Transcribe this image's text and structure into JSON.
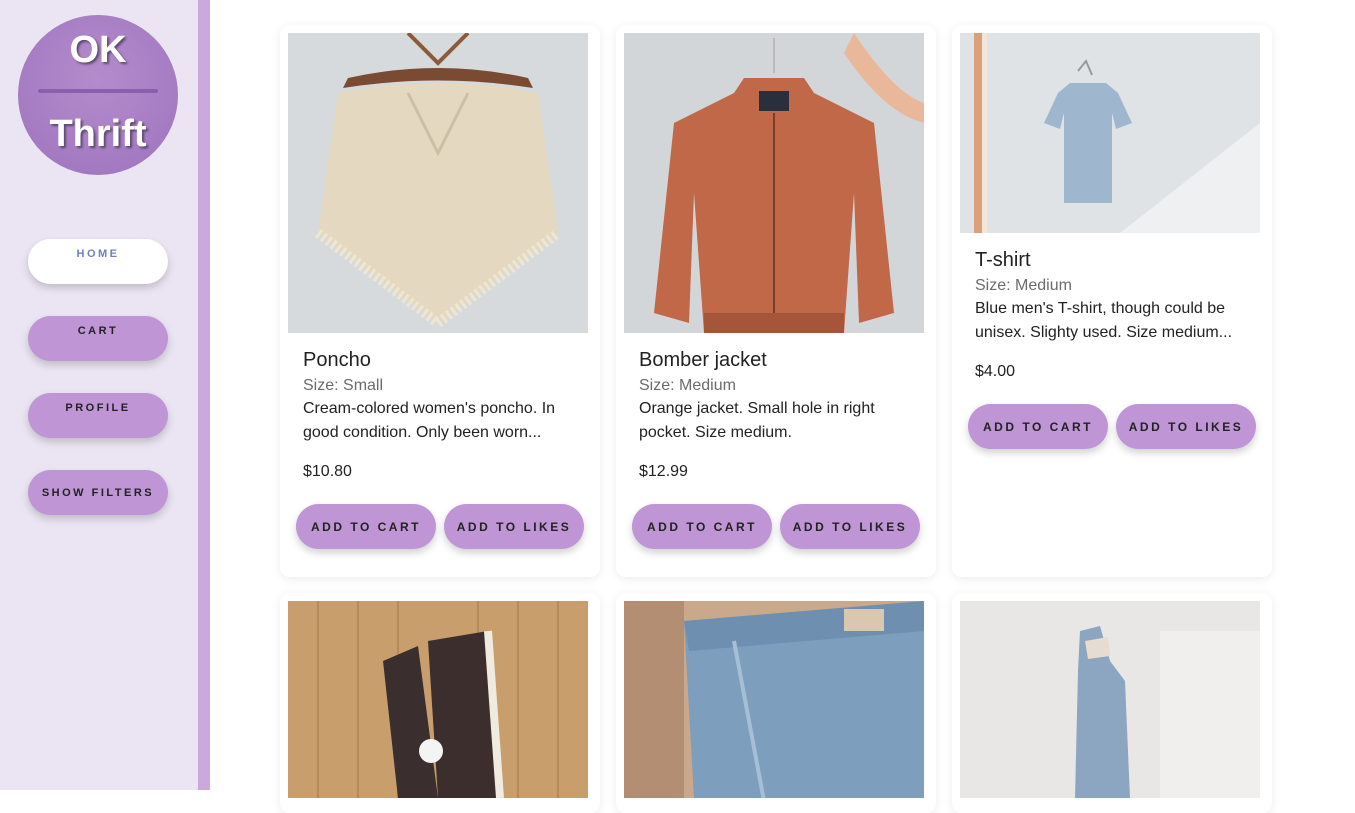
{
  "logo": {
    "top": "OK",
    "bottom": "Thrift"
  },
  "nav": {
    "home": "HOME",
    "cart": "CART",
    "profile": "PROFILE",
    "filters": "SHOW FILTERS"
  },
  "products": [
    {
      "title": "Poncho",
      "size": "Size: Small",
      "description": "Cream-colored women's poncho. In good condition. Only been worn...",
      "price": "$10.80",
      "add_to_cart": "ADD TO CART",
      "add_to_likes": "ADD TO LIKES",
      "image": "cream-knit-poncho-photo"
    },
    {
      "title": "Bomber jacket",
      "size": "Size: Medium",
      "description": "Orange jacket. Small hole in right pocket. Size medium.",
      "price": "$12.99",
      "add_to_cart": "ADD TO CART",
      "add_to_likes": "ADD TO LIKES",
      "image": "orange-bomber-jacket-photo"
    },
    {
      "title": "T-shirt",
      "size": "Size: Medium",
      "description": "Blue men's T-shirt, though could be unisex. Slighty used. Size medium...",
      "price": "$4.00",
      "add_to_cart": "ADD TO CART",
      "add_to_likes": "ADD TO LIKES",
      "image": "blue-tshirt-photo"
    },
    {
      "image": "high-top-sneakers-photo"
    },
    {
      "image": "blue-jeans-photo"
    },
    {
      "image": "denim-jacket-photo"
    }
  ],
  "colors": {
    "accent": "#bf95d6",
    "sidebar_bg": "#ebe5f3",
    "sidebar_stripe": "#cba9df",
    "logo": "#a77bc4"
  }
}
